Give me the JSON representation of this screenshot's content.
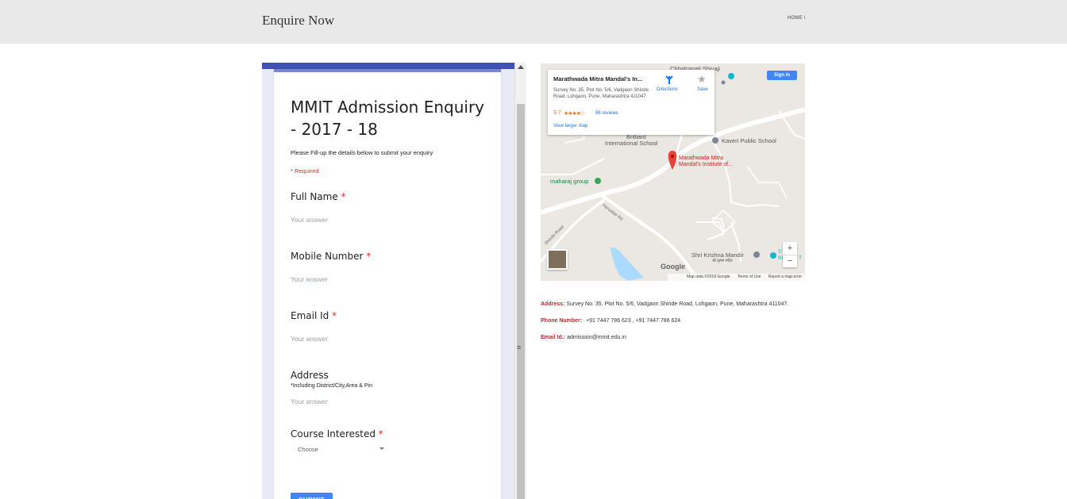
{
  "header": {
    "title": "Enquire Now",
    "breadcrumb": "HOME \\"
  },
  "form": {
    "title": "MMIT Admission Enquiry - 2017 - 18",
    "description": "Please Fill-up the details below to submit your enquiry",
    "required_note": "* Required",
    "questions": [
      {
        "label": "Full Name",
        "required_mark": "*",
        "placeholder": "Your answer"
      },
      {
        "label": "Mobile Number",
        "required_mark": "*",
        "placeholder": "Your answer"
      },
      {
        "label": "Email Id",
        "required_mark": "*",
        "placeholder": "Your answer"
      },
      {
        "label": "Address",
        "help": "*Including District/City,Area & Pin",
        "placeholder": "Your answer"
      },
      {
        "label": "Course Interested",
        "required_mark": "*",
        "select_value": "Choose"
      }
    ],
    "submit_label": "SUBMIT"
  },
  "map": {
    "card": {
      "name": "Marathwada Mitra Mandal's In...",
      "address": "Survey No. 35, Plot No. 5/6, Vadgaon Shinde Road, Lohgaon, Pune, Maharashtra 411047",
      "rating": "3.7",
      "stars": "★★★★☆",
      "reviews": "86 reviews",
      "larger_map": "View larger map",
      "directions_label": "Directions",
      "save_label": "Save"
    },
    "sign_in": "Sign in",
    "labels": {
      "chhatrapati": "Chhatrapati Shivaji",
      "brilliant": "Brilliant",
      "international_school": "International School",
      "kaveri": "Kaveri Public School",
      "mmm_institute": "Marathwada Mitra\nMandal's Institute of...",
      "maharaj": "maharaj group",
      "haruabai": "Haruabai Rd",
      "shinde_road": "Shinde Road",
      "krishna": "Shri Krishna Mandir",
      "krishna_local": "श्री कृष्ण मंदिर",
      "st": "ST",
      "in": "IN",
      "t": "T"
    },
    "zoom_in": "+",
    "zoom_out": "−",
    "google": "Google",
    "footer": {
      "data": "Map data ©2018 Google",
      "terms": "Terms of Use",
      "report": "Report a map error"
    },
    "colors": {
      "pin": "#ea4335",
      "water": "#aadaff",
      "road": "#ffffff",
      "land": "#ebe8e3"
    }
  },
  "contact": {
    "address_key": "Address:",
    "address_val": "Survey No. 35, Plot No. 5/6, Vadgaon Shinde Road, Lohgaon, Pune, Maharashtra 411047.",
    "phone_key": "Phone Number:",
    "phone_val": "+91 7447 786 623 ,   +91 7447 786 624",
    "email_key": "Email Id.:",
    "email_val": "admission@mmit.edu.in"
  }
}
